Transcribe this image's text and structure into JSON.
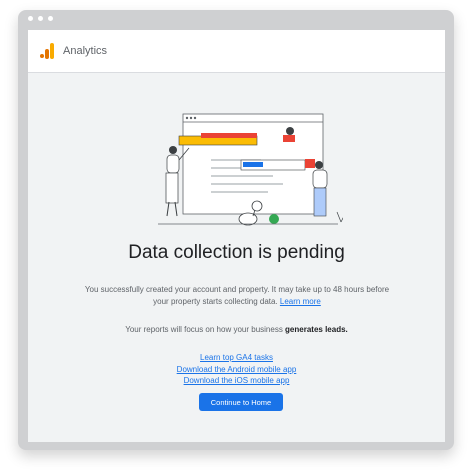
{
  "app": {
    "title": "Analytics",
    "logo_icon": "analytics-logo-icon"
  },
  "main": {
    "headline": "Data collection is pending",
    "description": "You successfully created your account and property. It may take up to 48 hours before your property starts collecting data.",
    "learn_more": "Learn more",
    "focus_prefix": "Your reports will focus on how your business",
    "focus_bold": "generates leads.",
    "links": [
      "Learn top GA4 tasks",
      "Download the Android mobile app",
      "Download the iOS mobile app"
    ],
    "cta": "Continue to Home"
  },
  "colors": {
    "accent": "#1a73e8",
    "logo_orange": "#e37400",
    "logo_yellow": "#f9ab00"
  }
}
